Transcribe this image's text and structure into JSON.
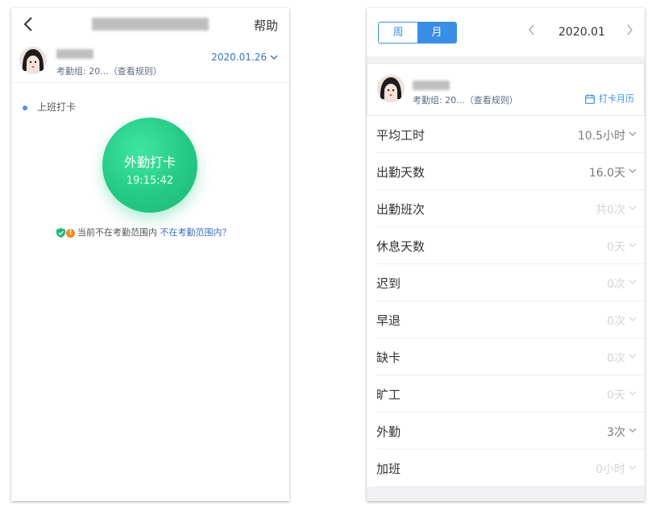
{
  "left_screen": {
    "header": {
      "help_label": "帮助"
    },
    "user": {
      "group_prefix": "考勤组: 20...",
      "rules_link": "（查看规则）",
      "date": "2020.01.26"
    },
    "section_label": "上班打卡",
    "punch": {
      "label": "外勤打卡",
      "time": "19:15:42",
      "color": "#25c985"
    },
    "location": {
      "status_text": "当前不在考勤范围内",
      "help_link": "不在考勤范围内？"
    }
  },
  "right_screen": {
    "toggle": {
      "week_label": "周",
      "month_label": "月",
      "selected": "月"
    },
    "month": "2020.01",
    "user": {
      "group_prefix": "考勤组: 20...",
      "rules_link": "（查看规则）",
      "calendar_link": "打卡月历"
    },
    "stats": [
      {
        "label": "平均工时",
        "value": "10.5小时",
        "emphasis": "dark"
      },
      {
        "label": "出勤天数",
        "value": "16.0天",
        "emphasis": "dark"
      },
      {
        "label": "出勤班次",
        "value": "共0次",
        "emphasis": "light"
      },
      {
        "label": "休息天数",
        "value": "0天",
        "emphasis": "light"
      },
      {
        "label": "迟到",
        "value": "0次",
        "emphasis": "light"
      },
      {
        "label": "早退",
        "value": "0次",
        "emphasis": "light"
      },
      {
        "label": "缺卡",
        "value": "0次",
        "emphasis": "light"
      },
      {
        "label": "旷工",
        "value": "0天",
        "emphasis": "light"
      },
      {
        "label": "外勤",
        "value": "3次",
        "emphasis": "dark"
      },
      {
        "label": "加班",
        "value": "0小时",
        "emphasis": "light"
      }
    ]
  },
  "icons": {
    "back": "chevron-left-icon",
    "date_dropdown": "chevron-down-icon",
    "shield": "shield-icon",
    "warning": "warning-icon",
    "calendar": "calendar-icon"
  },
  "colors": {
    "accent": "#3a8ee6",
    "link": "#3a6fbf",
    "punch_green": "#25c985",
    "warning": "#f58a1f"
  }
}
